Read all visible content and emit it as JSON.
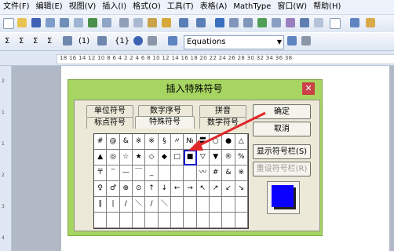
{
  "menubar": [
    "文件(F)",
    "编辑(E)",
    "视图(V)",
    "插入(I)",
    "格式(O)",
    "工具(T)",
    "表格(A)",
    "MathType",
    "窗口(W)",
    "帮助(H)"
  ],
  "toolbar2": {
    "sigma1": "Σ",
    "sigma2": "Σ",
    "sigma3": "Σ",
    "sigma4": "Σ",
    "num1": "(1)",
    "num2": "{1}",
    "equations_value": "Equations"
  },
  "ruler": {
    "text": "18  16  14  12  10   8   6   4   2       2   4   6   8   10  12  14  16  18  20  22  24  26  28  30  32  34  36  38"
  },
  "vruler": [
    "2",
    "1",
    "1",
    "2",
    "3",
    "4"
  ],
  "dialog": {
    "title": "插入特殊符号",
    "close": "✕",
    "tabs": {
      "unit_symbols": "单位符号",
      "number_symbols": "数字序号",
      "pinyin": "拼音",
      "punctuation": "标点符号",
      "special_symbols": "特殊符号",
      "math_symbols": "数学符号"
    },
    "grid": [
      [
        "#",
        "@",
        "&",
        "※",
        "※",
        "§",
        "〃",
        "№",
        "〓",
        "○",
        "●",
        "△"
      ],
      [
        "▲",
        "◎",
        "☆",
        "★",
        "◇",
        "◆",
        "□",
        "■",
        "▽",
        "▼",
        "®",
        "%"
      ],
      [
        "〒",
        "‾",
        "—",
        "￣",
        "_",
        "",
        "",
        "",
        "〰",
        "#",
        "&",
        "※"
      ],
      [
        "♀",
        "♂",
        "⊕",
        "⊙",
        "↑",
        "↓",
        "←",
        "→",
        "↖",
        "↗",
        "↙",
        "↘"
      ],
      [
        "∥",
        "∣",
        "/",
        "＼",
        "/",
        "＼",
        "",
        "",
        "",
        "",
        "",
        ""
      ],
      [
        "",
        "",
        "",
        "",
        "",
        "",
        "",
        "",
        "",
        "",
        "",
        ""
      ]
    ],
    "buttons": {
      "ok": "确定",
      "cancel": "取消",
      "show_toolbar": "显示符号栏(S)",
      "reset_toolbar": "重设符号栏(R)"
    },
    "preview_color": "#0b00ff"
  }
}
